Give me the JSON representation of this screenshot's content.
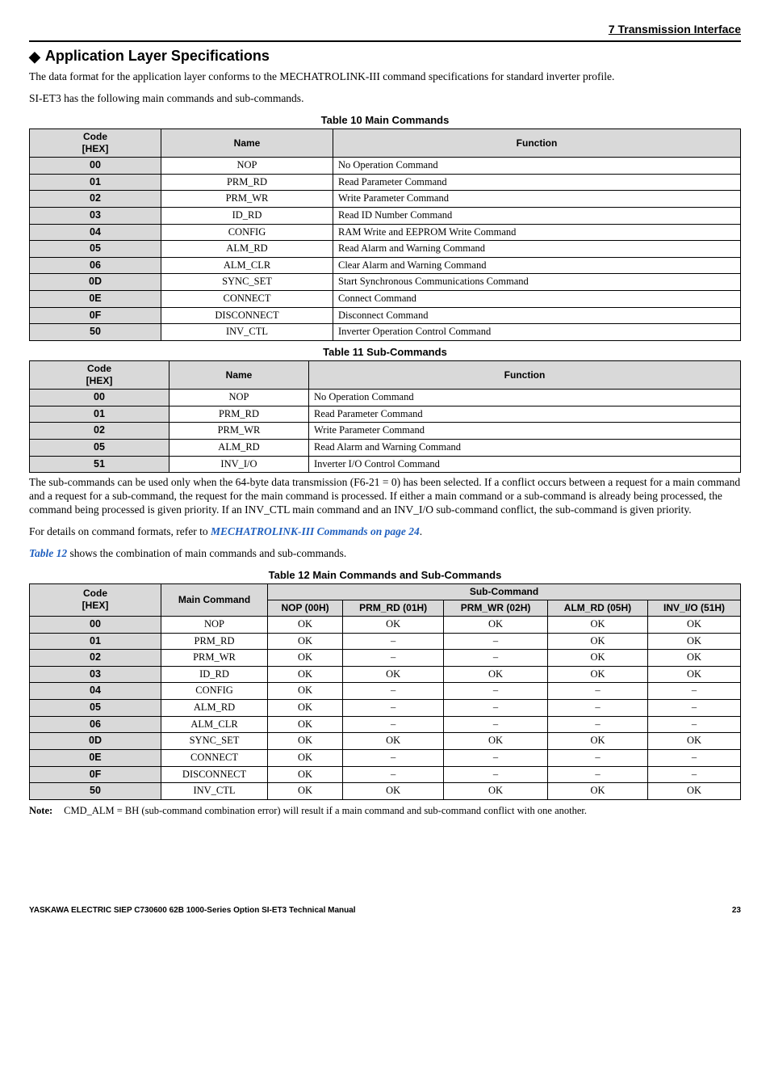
{
  "page_header": "7  Transmission Interface",
  "heading": "Application Layer Specifications",
  "intro1": "The data format for the application layer conforms to the MECHATROLINK-III command specifications for standard inverter profile.",
  "intro2": "SI-ET3 has the following main commands and sub-commands.",
  "table10_caption": "Table 10  Main Commands",
  "cols_t10": {
    "c1": "Code\n[HEX]",
    "c2": "Name",
    "c3": "Function"
  },
  "t10": [
    {
      "code": "00",
      "name": "NOP",
      "func": "No Operation Command"
    },
    {
      "code": "01",
      "name": "PRM_RD",
      "func": "Read Parameter Command"
    },
    {
      "code": "02",
      "name": "PRM_WR",
      "func": "Write Parameter Command"
    },
    {
      "code": "03",
      "name": "ID_RD",
      "func": "Read ID Number Command"
    },
    {
      "code": "04",
      "name": "CONFIG",
      "func": "RAM Write and EEPROM Write Command"
    },
    {
      "code": "05",
      "name": "ALM_RD",
      "func": "Read Alarm and Warning Command"
    },
    {
      "code": "06",
      "name": "ALM_CLR",
      "func": "Clear Alarm and Warning Command"
    },
    {
      "code": "0D",
      "name": "SYNC_SET",
      "func": "Start Synchronous Communications Command"
    },
    {
      "code": "0E",
      "name": "CONNECT",
      "func": "Connect Command"
    },
    {
      "code": "0F",
      "name": "DISCONNECT",
      "func": "Disconnect Command"
    },
    {
      "code": "50",
      "name": "INV_CTL",
      "func": "Inverter Operation Control Command"
    }
  ],
  "table11_caption": "Table 11  Sub-Commands",
  "t11": [
    {
      "code": "00",
      "name": "NOP",
      "func": "No Operation Command"
    },
    {
      "code": "01",
      "name": "PRM_RD",
      "func": "Read Parameter Command"
    },
    {
      "code": "02",
      "name": "PRM_WR",
      "func": "Write Parameter Command"
    },
    {
      "code": "05",
      "name": "ALM_RD",
      "func": "Read Alarm and Warning Command"
    },
    {
      "code": "51",
      "name": "INV_I/O",
      "func": "Inverter I/O Control Command"
    }
  ],
  "para_after_t11": "The sub-commands can be used only when the 64-byte data transmission (F6-21 = 0) has been selected. If a conflict occurs between a request for a main command and a request for a sub-command, the request for the main command is processed. If either a main command or a sub-command is already being processed, the command being processed is given priority. If an INV_CTL main command and an INV_I/O sub-command conflict, the sub-command is given priority.",
  "para_link_pre": "For details on command formats, refer to ",
  "para_link": "MECHATROLINK-III Commands on page 24",
  "para_link_post": ".",
  "para_t12_pre": "Table 12",
  "para_t12_rest": " shows the combination of main commands and sub-commands.",
  "table12_caption": "Table 12  Main Commands and Sub-Commands",
  "t12_headers": {
    "code": "Code\n[HEX]",
    "main": "Main Command",
    "sub": "Sub-Command",
    "s1": "NOP (00H)",
    "s2": "PRM_RD (01H)",
    "s3": "PRM_WR (02H)",
    "s4": "ALM_RD (05H)",
    "s5": "INV_I/O (51H)"
  },
  "t12": [
    {
      "code": "00",
      "main": "NOP",
      "v": [
        "OK",
        "OK",
        "OK",
        "OK",
        "OK"
      ]
    },
    {
      "code": "01",
      "main": "PRM_RD",
      "v": [
        "OK",
        "–",
        "–",
        "OK",
        "OK"
      ]
    },
    {
      "code": "02",
      "main": "PRM_WR",
      "v": [
        "OK",
        "–",
        "–",
        "OK",
        "OK"
      ]
    },
    {
      "code": "03",
      "main": "ID_RD",
      "v": [
        "OK",
        "OK",
        "OK",
        "OK",
        "OK"
      ]
    },
    {
      "code": "04",
      "main": "CONFIG",
      "v": [
        "OK",
        "–",
        "–",
        "–",
        "–"
      ]
    },
    {
      "code": "05",
      "main": "ALM_RD",
      "v": [
        "OK",
        "–",
        "–",
        "–",
        "–"
      ]
    },
    {
      "code": "06",
      "main": "ALM_CLR",
      "v": [
        "OK",
        "–",
        "–",
        "–",
        "–"
      ]
    },
    {
      "code": "0D",
      "main": "SYNC_SET",
      "v": [
        "OK",
        "OK",
        "OK",
        "OK",
        "OK"
      ]
    },
    {
      "code": "0E",
      "main": "CONNECT",
      "v": [
        "OK",
        "–",
        "–",
        "–",
        "–"
      ]
    },
    {
      "code": "0F",
      "main": "DISCONNECT",
      "v": [
        "OK",
        "–",
        "–",
        "–",
        "–"
      ]
    },
    {
      "code": "50",
      "main": "INV_CTL",
      "v": [
        "OK",
        "OK",
        "OK",
        "OK",
        "OK"
      ]
    }
  ],
  "note_label": "Note:",
  "note_body": "CMD_ALM = BH (sub-command combination error) will result if a main command and sub-command conflict with one another.",
  "footer_left": "YASKAWA ELECTRIC SIEP C730600 62B 1000-Series Option SI-ET3 Technical Manual",
  "footer_right": "23"
}
